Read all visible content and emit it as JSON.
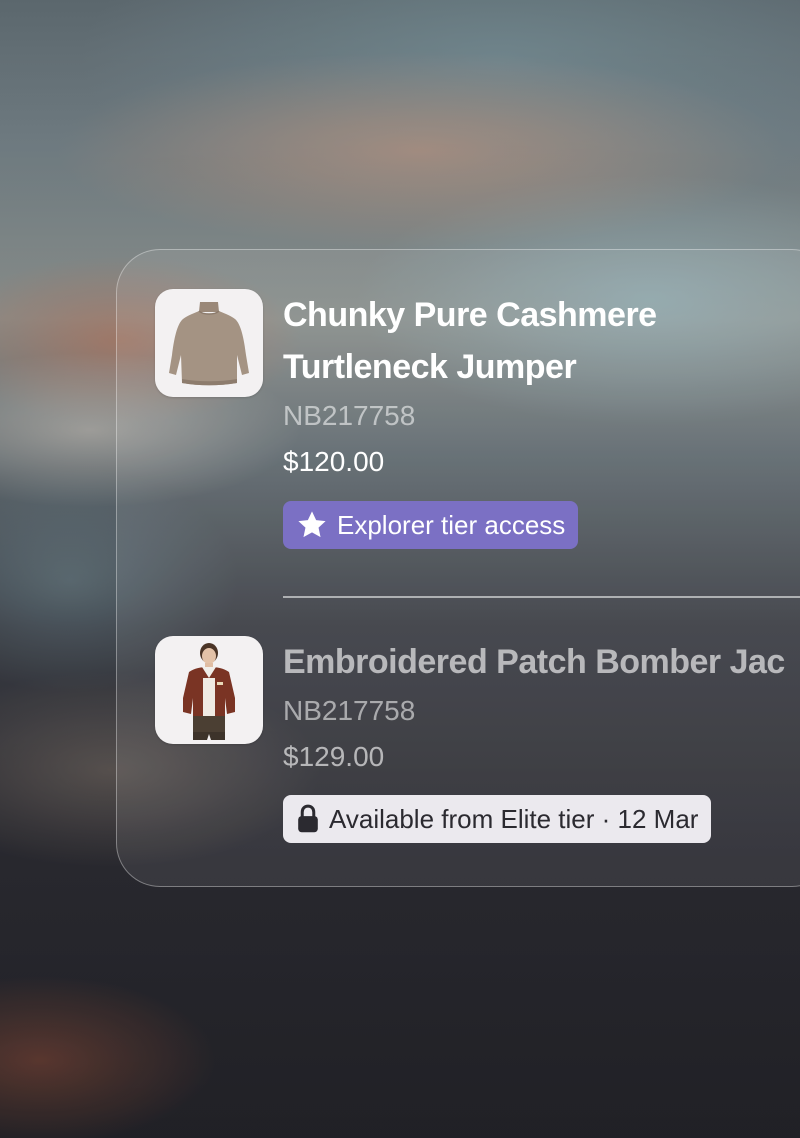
{
  "products": [
    {
      "title_line1": "Chunky Pure Cashmere",
      "title_line2": "Turtleneck Jumper",
      "sku": "NB217758",
      "price": "$120.00",
      "badge_icon": "star-icon",
      "badge_label": "Explorer tier access",
      "badge_color": "#7b70c4"
    },
    {
      "title": "Embroidered Patch Bomber Jac",
      "sku": "NB217758",
      "price": "$129.00",
      "badge_icon": "lock-icon",
      "badge_label": "Available from Elite tier · 12 Mar",
      "badge_color": "#ebe9ee"
    }
  ]
}
